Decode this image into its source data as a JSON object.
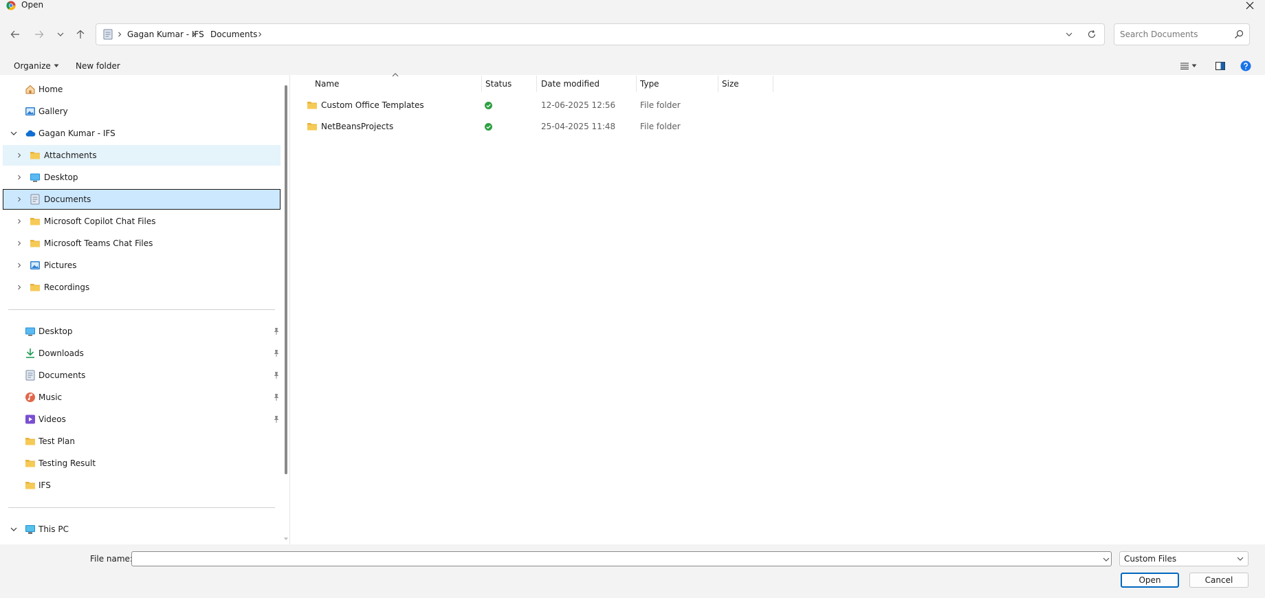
{
  "window": {
    "title": "Open"
  },
  "address": {
    "crumbs": [
      "Gagan Kumar - IFS",
      "Documents"
    ]
  },
  "search": {
    "placeholder": "Search Documents"
  },
  "toolbar": {
    "organize_label": "Organize",
    "new_folder_label": "New folder"
  },
  "nav": {
    "quick": [
      {
        "label": "Home",
        "icon": "home-icon"
      },
      {
        "label": "Gallery",
        "icon": "gallery-icon"
      },
      {
        "label": "Gagan Kumar - IFS",
        "icon": "cloud-icon"
      }
    ],
    "tree": [
      {
        "label": "Attachments",
        "icon": "folder-icon"
      },
      {
        "label": "Desktop",
        "icon": "desktop-icon"
      },
      {
        "label": "Documents",
        "icon": "documents-icon"
      },
      {
        "label": "Microsoft Copilot Chat Files",
        "icon": "folder-icon"
      },
      {
        "label": "Microsoft Teams Chat Files",
        "icon": "folder-icon"
      },
      {
        "label": "Pictures",
        "icon": "pictures-icon"
      },
      {
        "label": "Recordings",
        "icon": "folder-icon"
      }
    ],
    "pinned": [
      {
        "label": "Desktop",
        "icon": "desktop-icon"
      },
      {
        "label": "Downloads",
        "icon": "download-icon"
      },
      {
        "label": "Documents",
        "icon": "documents-icon"
      },
      {
        "label": "Music",
        "icon": "music-icon"
      },
      {
        "label": "Videos",
        "icon": "videos-icon"
      },
      {
        "label": "Test Plan",
        "icon": "folder-icon"
      },
      {
        "label": "Testing Result",
        "icon": "folder-icon"
      },
      {
        "label": "IFS",
        "icon": "folder-icon"
      }
    ],
    "this_pc": {
      "label": "This PC",
      "icon": "monitor-icon"
    }
  },
  "columns": {
    "name": "Name",
    "status": "Status",
    "date": "Date modified",
    "type": "Type",
    "size": "Size"
  },
  "files": [
    {
      "name": "Custom Office Templates",
      "date": "12-06-2025 12:56",
      "type": "File folder"
    },
    {
      "name": "NetBeansProjects",
      "date": "25-04-2025 11:48",
      "type": "File folder"
    }
  ],
  "bottom": {
    "file_name_label": "File name:",
    "file_name_value": "",
    "filter": "Custom Files",
    "open_label": "Open",
    "cancel_label": "Cancel"
  },
  "colors": {
    "accent": "#0067c0",
    "folder": "#f4c64d",
    "status_ok": "#2ea043",
    "selection": "#cce8ff"
  }
}
